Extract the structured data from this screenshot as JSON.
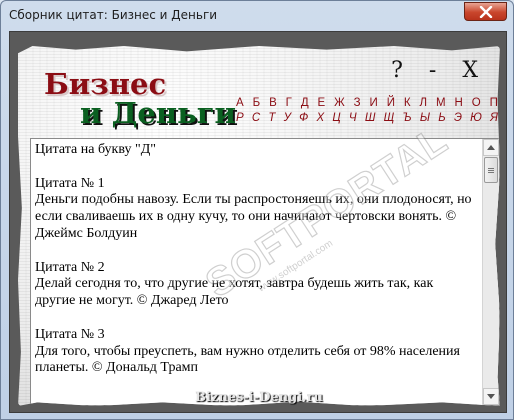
{
  "window": {
    "title": "Сборник цитат: Бизнес и Деньги"
  },
  "logo": {
    "line1": "Бизнес",
    "line2": "и Деньги",
    "colors": {
      "line1": "#8b0d14",
      "line2": "#0a5f20"
    }
  },
  "controls": {
    "help": "?",
    "minimize": "-",
    "close": "X"
  },
  "alphabet": {
    "row1": [
      "А",
      "Б",
      "В",
      "Г",
      "Д",
      "Е",
      "Ж",
      "З",
      "И",
      "Й",
      "К",
      "Л",
      "М",
      "Н",
      "О",
      "П"
    ],
    "row2": [
      "Р",
      "С",
      "Т",
      "У",
      "Ф",
      "Х",
      "Ц",
      "Ч",
      "Ш",
      "Щ",
      "Ъ",
      "Ы",
      "Ь",
      "Э",
      "Ю",
      "Я"
    ],
    "color": "#8b0d14"
  },
  "content": {
    "heading": "Цитата на букву \"Д\"",
    "quotes": [
      {
        "number": "Цитата № 1",
        "text": "Деньги подобны навозу. Если ты распростоняешь их, они плодоносят, но если сваливаешь их в одну кучу, то они начинают чертовски вонять. © Джеймс Болдуин"
      },
      {
        "number": "Цитата № 2",
        "text": "Делай сегодня то, что другие не хотят, завтра будешь жить так, как другие не могут. © Джаред Лето"
      },
      {
        "number": "Цитата № 3",
        "text": "Для того, чтобы преуспеть, вам нужно отделить себя от 98% населения планеты. © Дональд Трамп"
      }
    ]
  },
  "watermark": {
    "main": "SOFTPORTAL",
    "sub": "www.softportal.com"
  },
  "footer": {
    "site": "Biznes-i-Dengi.ru"
  }
}
